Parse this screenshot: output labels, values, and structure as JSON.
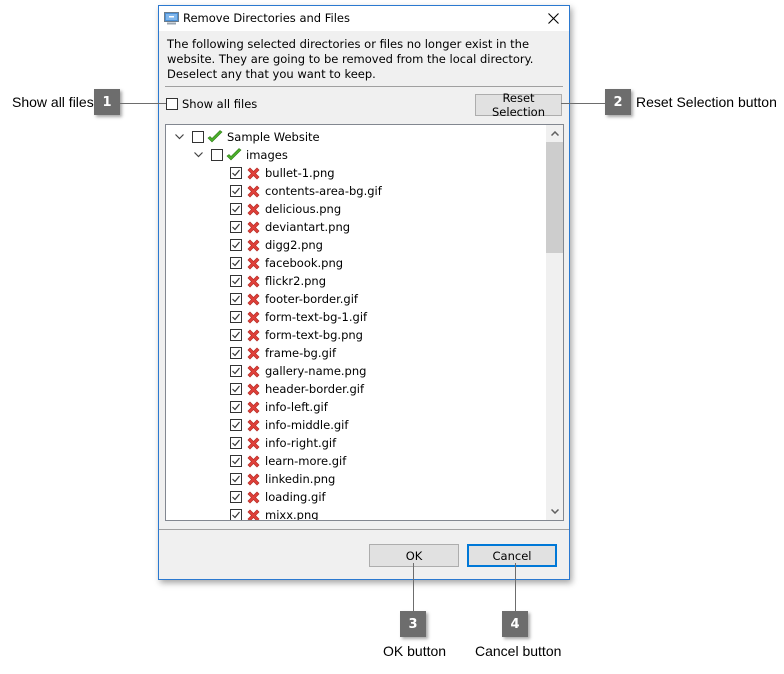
{
  "dialog": {
    "title": "Remove Directories and Files",
    "icon": "monitor-app-icon",
    "close_icon": "close-icon",
    "message": "The following selected directories or files no longer exist in the website. They are going to be removed from the local directory. Deselect any that you want to keep.",
    "show_all_files": {
      "label": "Show all files",
      "checked": false
    },
    "reset_selection_label": "Reset Selection",
    "tree": {
      "root": {
        "label": "Sample Website",
        "checked": false,
        "expanded": true,
        "status": "check-green"
      },
      "folder": {
        "label": "images",
        "checked": false,
        "expanded": true,
        "status": "check-green"
      },
      "files": [
        "bullet-1.png",
        "contents-area-bg.gif",
        "delicious.png",
        "deviantart.png",
        "digg2.png",
        "facebook.png",
        "flickr2.png",
        "footer-border.gif",
        "form-text-bg-1.gif",
        "form-text-bg.png",
        "frame-bg.gif",
        "gallery-name.png",
        "header-border.gif",
        "info-left.gif",
        "info-middle.gif",
        "info-right.gif",
        "learn-more.gif",
        "linkedin.png",
        "loading.gif",
        "mixx.png"
      ],
      "file_checked": true,
      "file_status": "delete-red-x"
    },
    "ok_label": "OK",
    "cancel_label": "Cancel"
  },
  "callouts": [
    {
      "number": "1",
      "label": "Show all files"
    },
    {
      "number": "2",
      "label": "Reset Selection button"
    },
    {
      "number": "3",
      "label": "OK button"
    },
    {
      "number": "4",
      "label": "Cancel button"
    }
  ],
  "colors": {
    "accent": "#0078d7",
    "dialog_border": "#2b79d0",
    "callout_box": "#6d6d6d",
    "check_green": "#4caf2a",
    "delete_red": "#e0403a"
  }
}
